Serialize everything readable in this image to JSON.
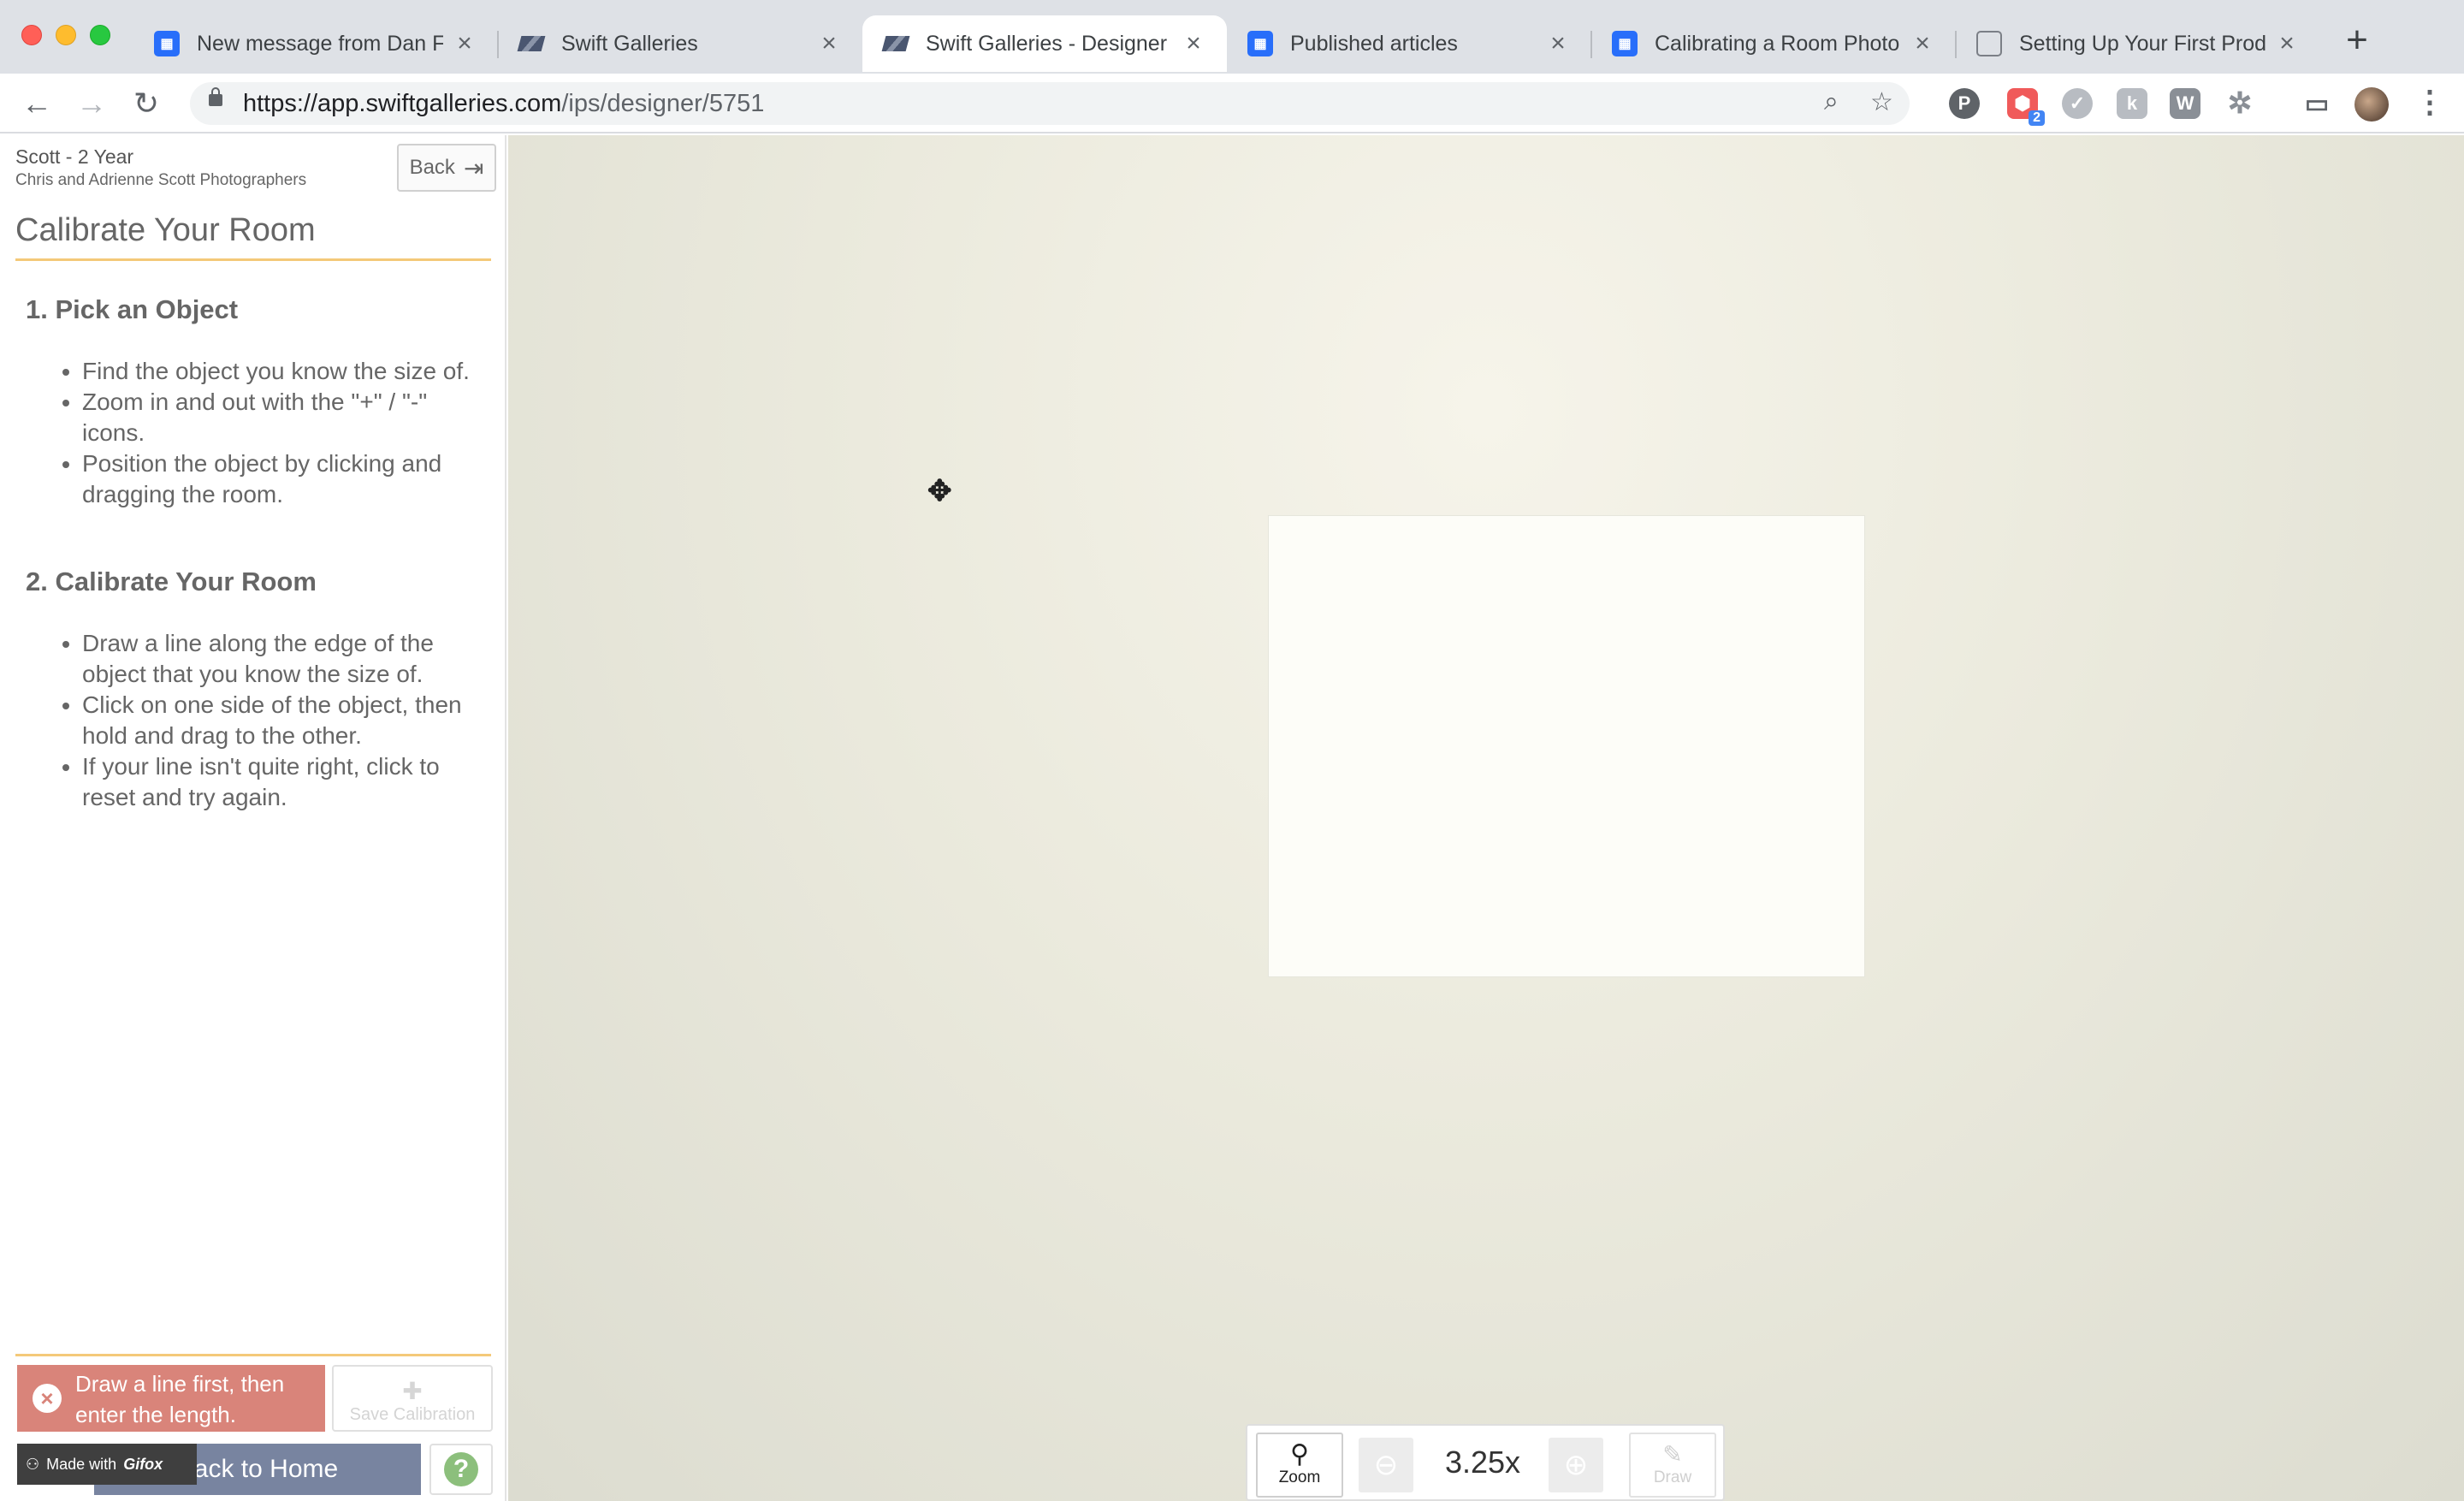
{
  "browser": {
    "tabs": [
      {
        "title": "New message from Dan Fr",
        "favicon": "intercom-icon"
      },
      {
        "title": "Swift Galleries",
        "favicon": "swift-galleries-icon"
      },
      {
        "title": "Swift Galleries - Designer",
        "favicon": "swift-galleries-icon",
        "active": true
      },
      {
        "title": "Published articles",
        "favicon": "intercom-icon"
      },
      {
        "title": "Calibrating a Room Photo",
        "favicon": "intercom-icon"
      },
      {
        "title": "Setting Up Your First Prod",
        "favicon": "book-icon"
      }
    ],
    "url_host": "https://app.swiftgalleries.com",
    "url_path": "/ips/designer/5751",
    "extension_badge": "2"
  },
  "sidebar": {
    "project_name": "Scott - 2 Year",
    "client_name": "Chris and Adrienne Scott Photographers",
    "back_label": "Back",
    "title": "Calibrate Your Room",
    "steps": [
      {
        "heading": "1. Pick an Object",
        "bullets": [
          "Find the object you know the size of.",
          "Zoom in and out with the \"+\" / \"-\" icons.",
          "Position the object by clicking and dragging the room."
        ]
      },
      {
        "heading": "2. Calibrate Your Room",
        "bullets": [
          "Draw a line along the edge of the object that you know the size of.",
          "Click on one side of the object, then hold and drag to the other.",
          "If your line isn't quite right, click to reset and try again."
        ]
      }
    ],
    "error_message": "Draw a line first, then enter the length.",
    "save_label": "Save Calibration",
    "home_label": "Back to Home",
    "gifox_prefix": "Made with",
    "gifox_brand": "Gifox",
    "help_label": "?"
  },
  "canvas": {
    "zoom_label": "Zoom",
    "zoom_level": "3.25x",
    "draw_label": "Draw"
  },
  "colors": {
    "accent_rule": "#f4c979",
    "error": "#d9847a",
    "home_button": "#7884a0",
    "help": "#8cbf7c"
  }
}
